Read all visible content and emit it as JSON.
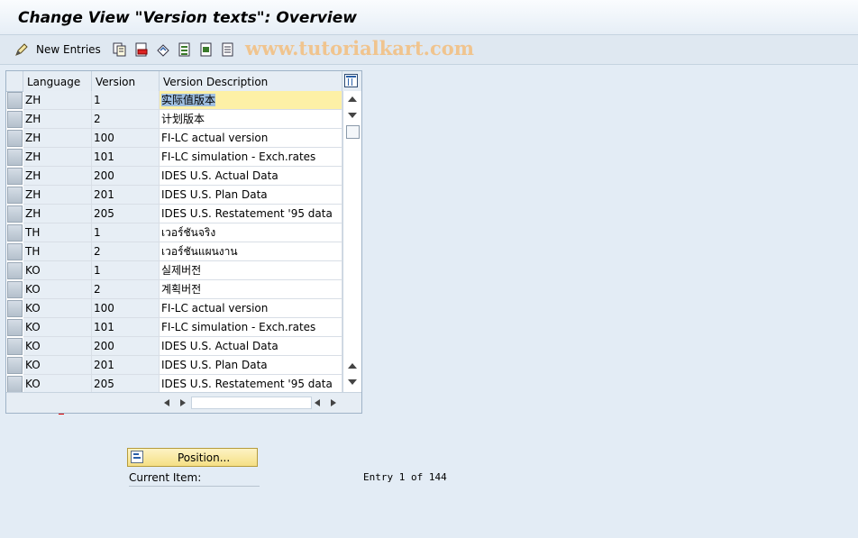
{
  "window": {
    "title": "Change View \"Version texts\": Overview"
  },
  "toolbar": {
    "new_entries_label": "New Entries",
    "icons": [
      "edit-icon",
      "copy-icon",
      "delete-icon",
      "undo-icon",
      "select-all-icon",
      "select-block-icon",
      "deselect-all-icon"
    ]
  },
  "watermark": "www.tutorialkart.com",
  "table": {
    "columns": [
      "Language",
      "Version",
      "Version Description"
    ],
    "rows": [
      {
        "lang": "ZH",
        "ver": "1",
        "desc": "实际值版本"
      },
      {
        "lang": "ZH",
        "ver": "2",
        "desc": "计划版本"
      },
      {
        "lang": "ZH",
        "ver": "100",
        "desc": "FI-LC actual version"
      },
      {
        "lang": "ZH",
        "ver": "101",
        "desc": "FI-LC simulation - Exch.rates"
      },
      {
        "lang": "ZH",
        "ver": "200",
        "desc": "IDES U.S. Actual Data"
      },
      {
        "lang": "ZH",
        "ver": "201",
        "desc": "IDES U.S. Plan Data"
      },
      {
        "lang": "ZH",
        "ver": "205",
        "desc": "IDES U.S. Restatement '95 data"
      },
      {
        "lang": "TH",
        "ver": "1",
        "desc": "เวอร์ชันจริง"
      },
      {
        "lang": "TH",
        "ver": "2",
        "desc": "เวอร์ชันแผนงาน"
      },
      {
        "lang": "KO",
        "ver": "1",
        "desc": "실제버전"
      },
      {
        "lang": "KO",
        "ver": "2",
        "desc": "계획버전"
      },
      {
        "lang": "KO",
        "ver": "100",
        "desc": "FI-LC actual version"
      },
      {
        "lang": "KO",
        "ver": "101",
        "desc": "FI-LC simulation - Exch.rates"
      },
      {
        "lang": "KO",
        "ver": "200",
        "desc": "IDES U.S. Actual Data"
      },
      {
        "lang": "KO",
        "ver": "201",
        "desc": "IDES U.S. Plan Data"
      },
      {
        "lang": "KO",
        "ver": "205",
        "desc": "IDES U.S. Restatement '95 data"
      }
    ]
  },
  "footer": {
    "position_label": "Position...",
    "current_item_label": "Current Item:",
    "entry_text": "Entry 1 of 144"
  }
}
